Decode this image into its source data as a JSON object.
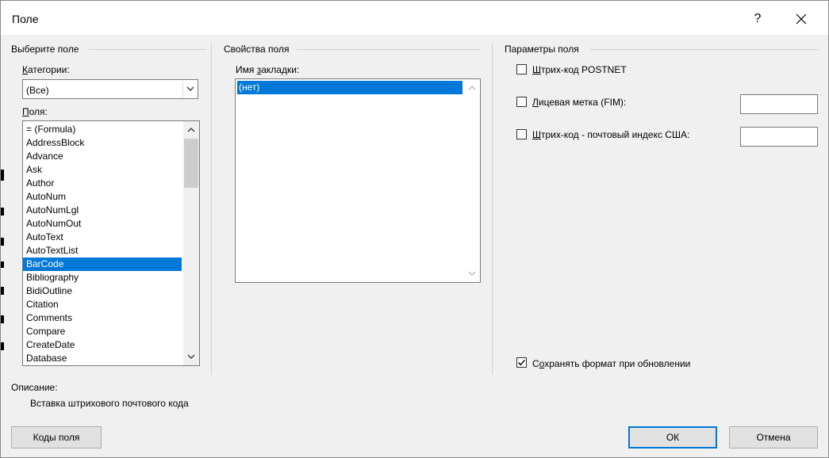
{
  "window": {
    "title": "Поле",
    "help_label": "?",
    "close_icon": "close-icon"
  },
  "choose_field": {
    "group_title": "Выберите поле",
    "categories_label_u": "К",
    "categories_label_rest": "атегории:",
    "category_value": "(Все)",
    "fields_label_u": "П",
    "fields_label_rest": "оля:",
    "fields": [
      "= (Formula)",
      "AddressBlock",
      "Advance",
      "Ask",
      "Author",
      "AutoNum",
      "AutoNumLgl",
      "AutoNumOut",
      "AutoText",
      "AutoTextList",
      "BarCode",
      "Bibliography",
      "BidiOutline",
      "Citation",
      "Comments",
      "Compare",
      "CreateDate",
      "Database"
    ],
    "selected_field": "BarCode"
  },
  "field_properties": {
    "group_title": "Свойства поля",
    "bookmark_label_pre": "Имя ",
    "bookmark_label_u": "з",
    "bookmark_label_rest": "акладки:",
    "bookmarks": [
      "(нет)"
    ]
  },
  "field_options": {
    "group_title": "Параметры поля",
    "postnet_u": "Ш",
    "postnet_rest": "трих-код POSTNET",
    "postnet_checked": false,
    "fim_u": "Л",
    "fim_rest": "ицевая метка (FIM):",
    "fim_checked": false,
    "fim_value": "",
    "zip_u": "Ш",
    "zip_rest": "трих-код - почтовый индекс США:",
    "zip_checked": false,
    "zip_value": "",
    "preserve_pre": "С",
    "preserve_u": "о",
    "preserve_rest": "хранять формат при обновлении",
    "preserve_checked": true
  },
  "description": {
    "label": "Описание:",
    "text": "Вставка штрихового почтового кода"
  },
  "buttons": {
    "field_codes": "Коды поля",
    "ok": "ОК",
    "cancel": "Отмена"
  },
  "colors": {
    "selection": "#0078d7",
    "dialog_bg": "#f0f0f0"
  }
}
